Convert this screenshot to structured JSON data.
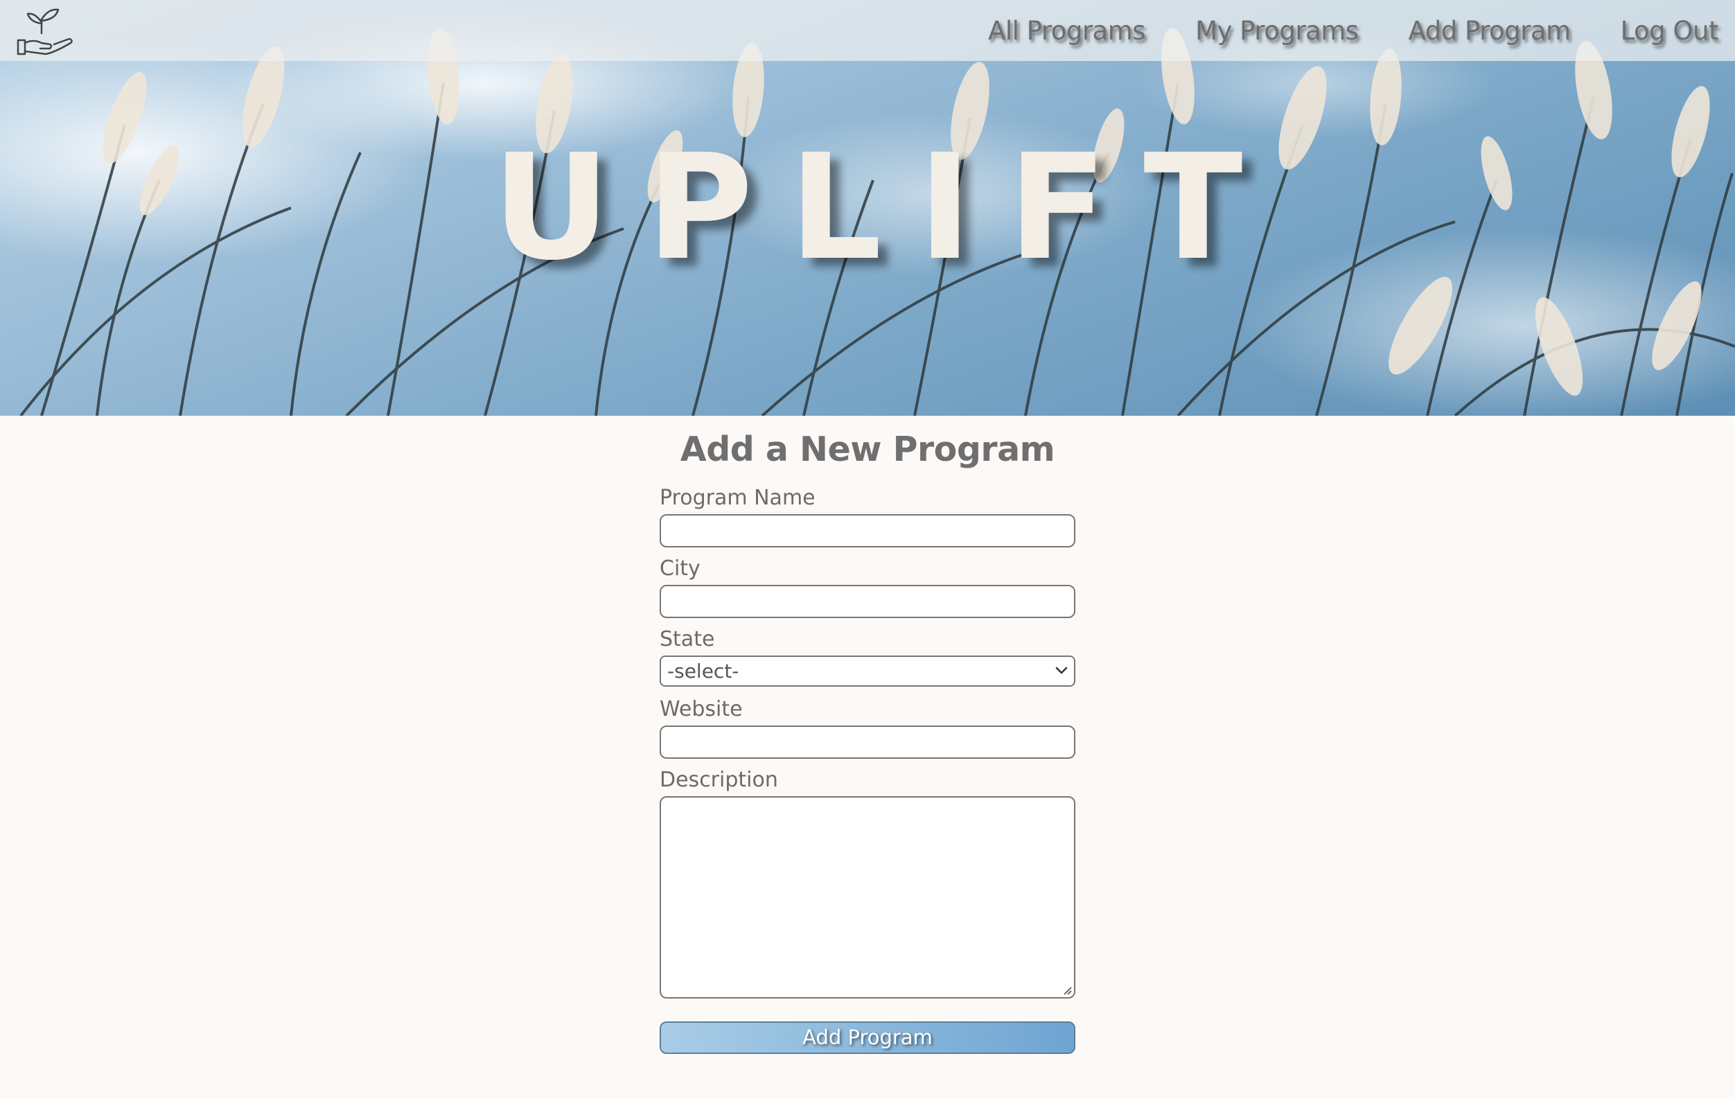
{
  "header": {
    "logo_icon": "hand-sprout-icon",
    "brand": "UPLIFT",
    "nav": [
      {
        "label": "All Programs"
      },
      {
        "label": "My Programs"
      },
      {
        "label": "Add Program"
      },
      {
        "label": "Log Out"
      }
    ]
  },
  "form": {
    "title": "Add a New Program",
    "program_name": {
      "label": "Program Name",
      "value": ""
    },
    "city": {
      "label": "City",
      "value": ""
    },
    "state": {
      "label": "State",
      "selected": "-select-"
    },
    "website": {
      "label": "Website",
      "value": ""
    },
    "description": {
      "label": "Description",
      "value": ""
    },
    "submit_label": "Add Program"
  },
  "colors": {
    "page_background": "#fdf9f7",
    "text_gray": "#6f6f6f",
    "brand_text": "#f3eee6",
    "button_gradient_start": "#a9cce7",
    "button_gradient_end": "#6fa4d2"
  }
}
